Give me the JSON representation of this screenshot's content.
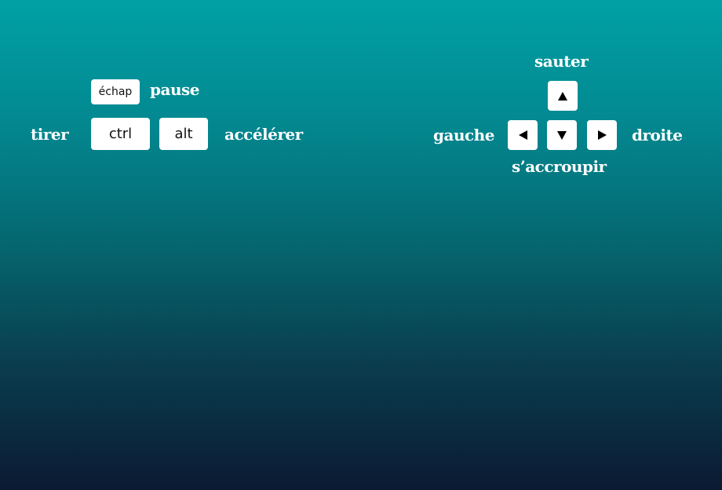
{
  "keys": {
    "escape": "échap",
    "ctrl": "ctrl",
    "alt": "alt"
  },
  "labels": {
    "pause": "pause",
    "shoot": "tirer",
    "accelerate": "accélérer",
    "jump": "sauter",
    "left": "gauche",
    "right": "droite",
    "crouch": "s’accroupir"
  },
  "colors": {
    "gradient_top": "#00a1a5",
    "gradient_bottom": "#0b1a33",
    "key": "#ffffff"
  }
}
